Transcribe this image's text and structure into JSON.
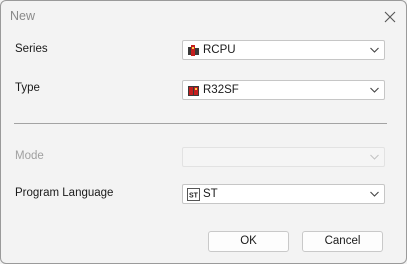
{
  "window": {
    "title": "New"
  },
  "form": {
    "series": {
      "label": "Series",
      "value": "RCPU",
      "icon": "rcpu-series-icon"
    },
    "type": {
      "label": "Type",
      "value": "R32SF",
      "icon": "cpu-module-icon"
    },
    "mode": {
      "label": "Mode",
      "value": "",
      "disabled": true
    },
    "language": {
      "label": "Program Language",
      "value": "ST",
      "icon": "st-language-icon"
    }
  },
  "buttons": {
    "ok": "OK",
    "cancel": "Cancel"
  },
  "colors": {
    "module_red": "#c41e1e",
    "module_dark": "#3a3a3a",
    "disabled_text": "#a0a0a0"
  }
}
